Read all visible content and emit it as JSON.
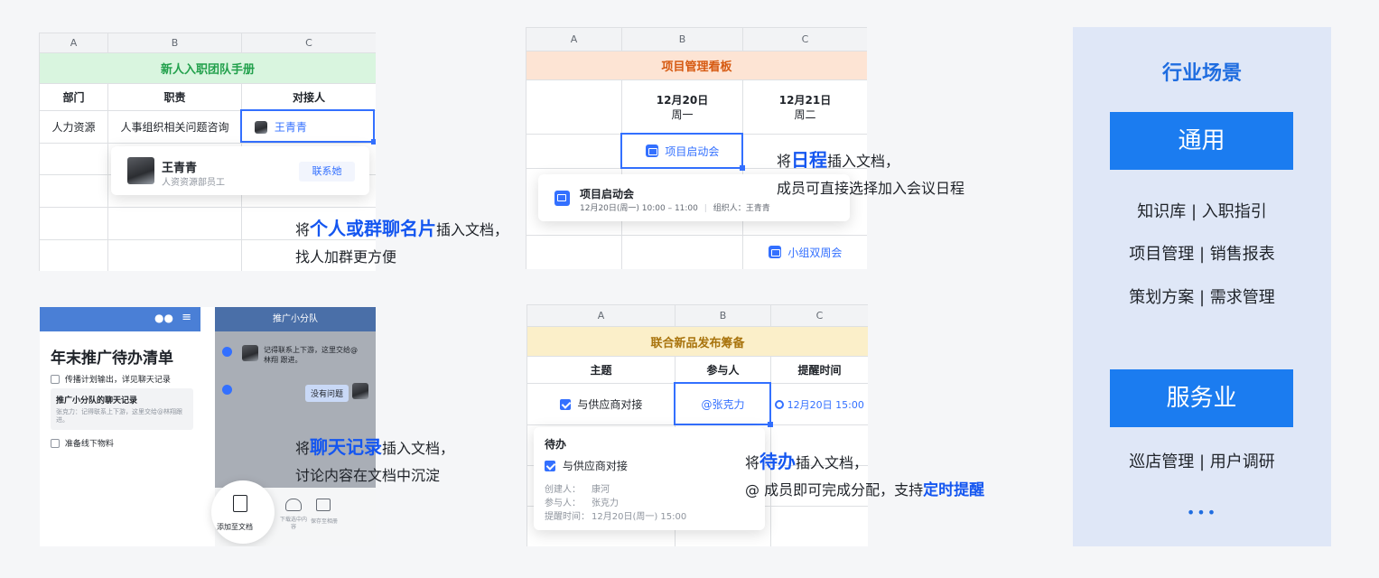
{
  "panel1": {
    "col_headers": [
      "A",
      "B",
      "C"
    ],
    "banner": "新人入职团队手册",
    "headers": [
      "部门",
      "职责",
      "对接人"
    ],
    "row": {
      "dept": "人力资源",
      "duty": "人事组织相关问题咨询",
      "contact": "王青青"
    },
    "card": {
      "name": "王青青",
      "title": "人资资源部员工",
      "button": "联系她"
    }
  },
  "caption1": {
    "prefix": "将",
    "highlight": "个人或群聊名片",
    "suffix": "插入文档，",
    "line2": "找人加群更方便"
  },
  "panel2": {
    "col_headers": [
      "A",
      "B",
      "C"
    ],
    "banner": "项目管理看板",
    "days": [
      {
        "date": "12月20日",
        "weekday": "周一"
      },
      {
        "date": "12月21日",
        "weekday": "周二"
      }
    ],
    "event_chip": "项目启动会",
    "card": {
      "title": "项目启动会",
      "time": "12月20日(周一) 10:00 – 11:00",
      "organizer": "组织人：王青青"
    },
    "event_chip2": "小组双周会"
  },
  "caption2": {
    "prefix": "将",
    "highlight": "日程",
    "suffix": "插入文档，",
    "line2": "成员可直接选择加入会议日程"
  },
  "panel3": {
    "left": {
      "title": "年末推广待办清单",
      "task1": "传播计划输出，详见聊天记录",
      "chat_title": "推广小分队的聊天记录",
      "chat_preview": "张克力：记得联系上下游，这里交给@林翔跟进。",
      "task2": "准备线下物料"
    },
    "right": {
      "header": "推广小分队",
      "msg1": "记得联系上下游，这里交给@林翔 跟进。",
      "msg2": "没有问题",
      "action_main": "添加至文档",
      "action2": "下载选中内容",
      "action3": "保存至相册"
    }
  },
  "caption3": {
    "prefix": "将",
    "highlight": "聊天记录",
    "suffix": "插入文档，",
    "line2": "讨论内容在文档中沉淀"
  },
  "panel4": {
    "col_headers": [
      "A",
      "B",
      "C"
    ],
    "banner": "联合新品发布筹备",
    "headers": [
      "主题",
      "参与人",
      "提醒时间"
    ],
    "row": {
      "topic": "与供应商对接",
      "person": "@张克力",
      "time": "12月20日 15:00"
    },
    "card": {
      "title": "待办",
      "task": "与供应商对接",
      "creator_label": "创建人：",
      "creator": "康河",
      "member_label": "参与人：",
      "member": "张克力",
      "remind_label": "提醒时间：",
      "remind": "12月20日(周一) 15:00"
    }
  },
  "caption4": {
    "prefix": "将",
    "highlight": "待办",
    "suffix": "插入文档，",
    "line2_prefix": "@ 成员即可完成分配，支持",
    "line2_highlight": "定时提醒"
  },
  "sidebar": {
    "title": "行业场景",
    "btn1": "通用",
    "line1": "知识库 | 入职指引",
    "line2": "项目管理 | 销售报表",
    "line3": "策划方案 | 需求管理",
    "btn2": "服务业",
    "line4": "巡店管理 | 用户调研",
    "more": "•••"
  },
  "colors": {
    "accent": "#3370ff",
    "highlight_text": "#1456f0",
    "sidebar_bg": "#dfe7f7",
    "sidebar_button": "#1b7cf0"
  }
}
